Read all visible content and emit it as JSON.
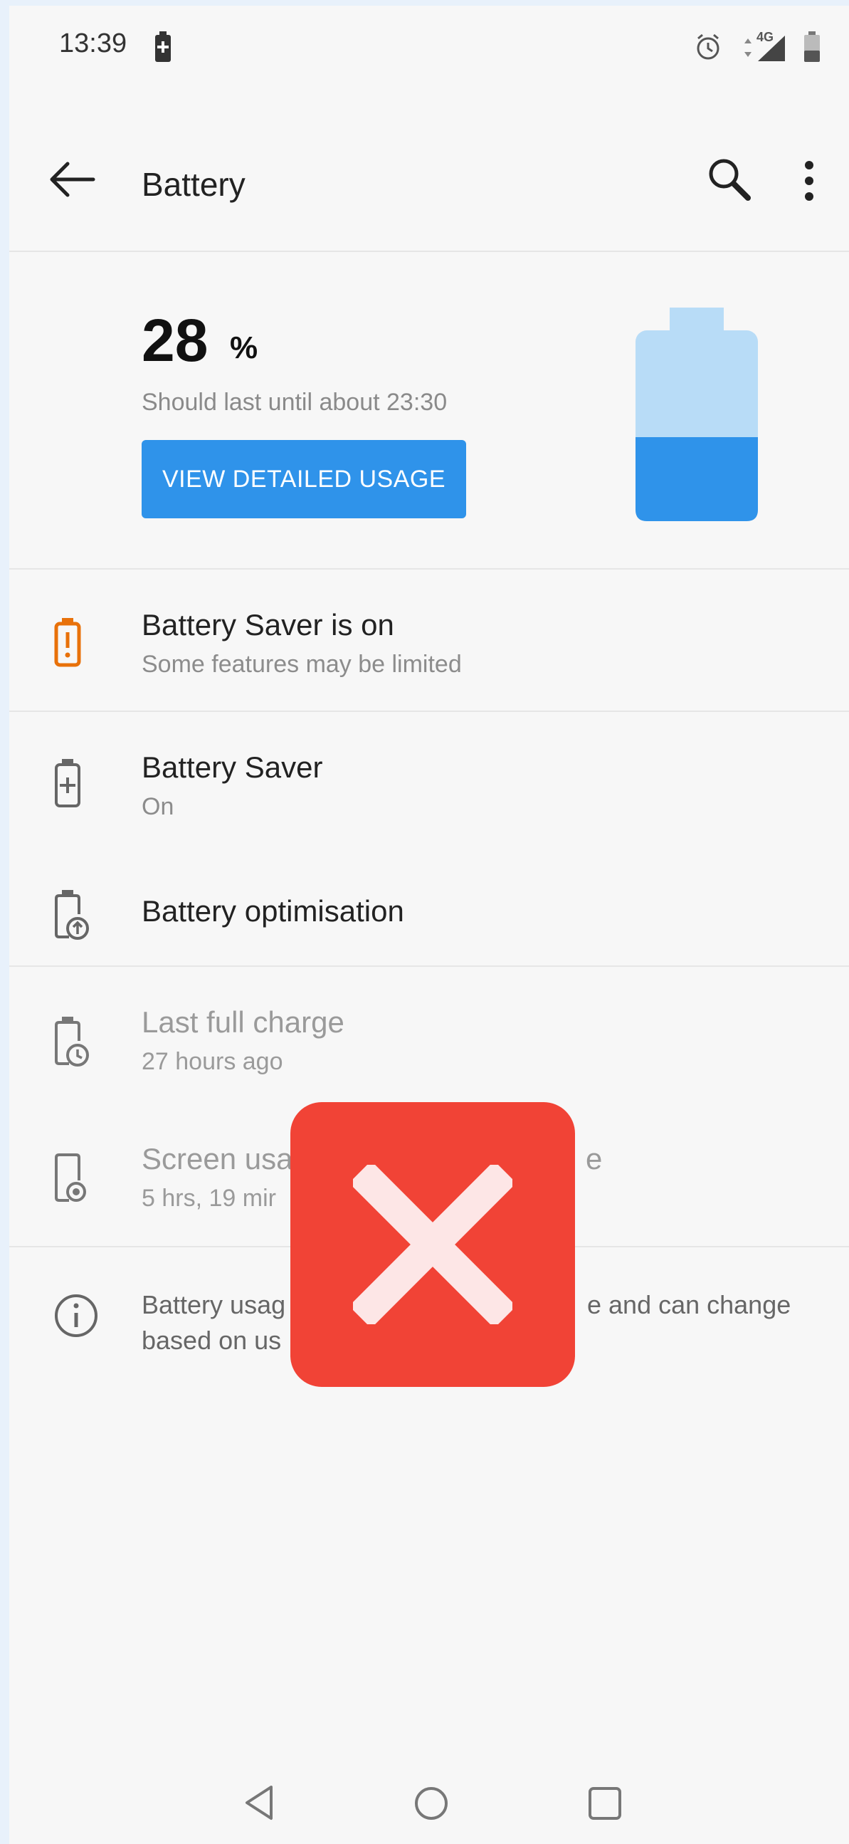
{
  "status_bar": {
    "time": "13:39",
    "icons": [
      "battery-saver-status-icon",
      "alarm-icon",
      "data-arrows-icon",
      "network-4g-label",
      "signal-icon",
      "battery-icon"
    ],
    "network_label": "4G"
  },
  "app_bar": {
    "title": "Battery",
    "icons": [
      "back-arrow-icon",
      "search-icon",
      "more-options-icon"
    ]
  },
  "hero": {
    "percent": "28",
    "percent_sign": "%",
    "estimate": "Should last until about 23:30",
    "button_label": "VIEW DETAILED USAGE",
    "battery_level": 0.28,
    "colors": {
      "battery_fill": "#2f93ea",
      "battery_empty": "#b8dcf7"
    }
  },
  "rows": [
    {
      "title": "Battery Saver is on",
      "subtitle": "Some features may be limited",
      "icon": "battery-alert-icon",
      "icon_color": "#e8710a"
    },
    {
      "title": "Battery Saver",
      "subtitle": "On",
      "icon": "battery-plus-icon"
    },
    {
      "title": "Battery optimisation",
      "icon": "battery-optimisation-icon"
    },
    {
      "title": "Last full charge",
      "subtitle": "27 hours ago",
      "icon": "battery-clock-icon"
    },
    {
      "title": "Screen usa",
      "title_tail": "e",
      "subtitle": "5 hrs, 19 mir",
      "icon": "screen-usage-icon"
    }
  ],
  "info": {
    "line1_start": "Battery usag",
    "line1_end": "e and can change",
    "line2": "based on us",
    "icon": "info-icon"
  },
  "nav_bar": {
    "icons": [
      "back-triangle-icon",
      "home-circle-icon",
      "recents-square-icon"
    ]
  },
  "overlay": {
    "icon": "close-x-icon",
    "color": "#f14336"
  }
}
